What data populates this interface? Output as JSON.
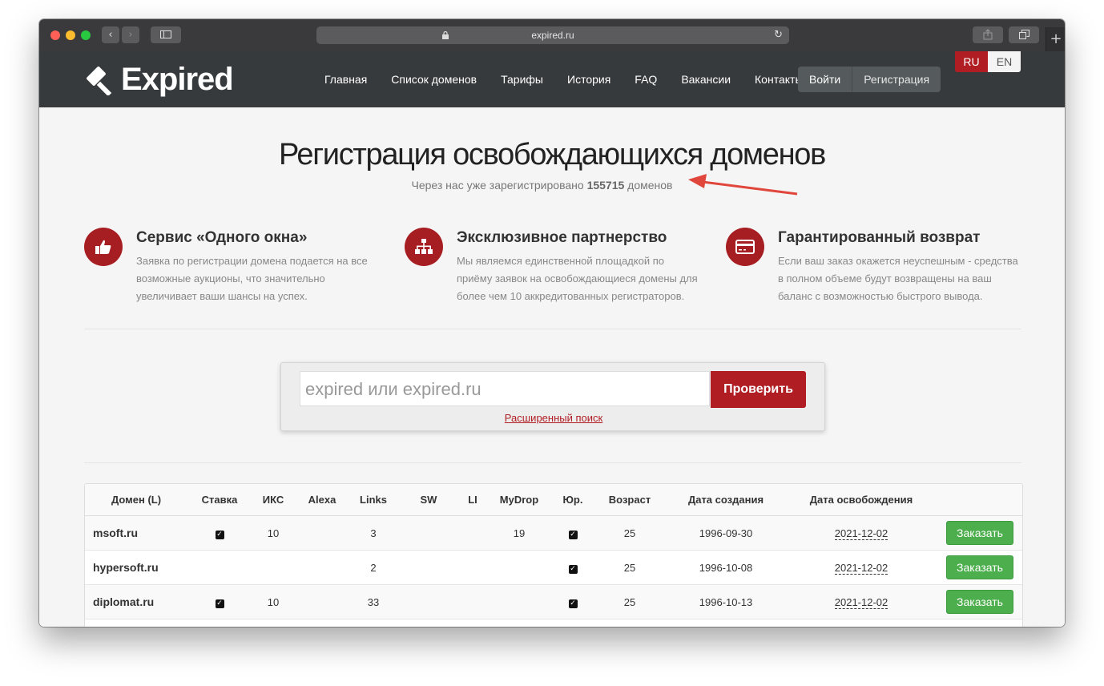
{
  "browser": {
    "url": "expired.ru",
    "back_icon": "chevron-left",
    "forward_icon": "chevron-right",
    "sidebar_icon": "sidebar",
    "share_icon": "share",
    "tabs_icon": "tabs",
    "new_tab_label": "+"
  },
  "header": {
    "logo_text": "Expired",
    "nav": [
      "Главная",
      "Список доменов",
      "Тарифы",
      "История",
      "FAQ",
      "Вакансии",
      "Контакты"
    ],
    "login": "Войти",
    "register": "Регистрация",
    "lang_ru": "RU",
    "lang_en": "EN"
  },
  "hero": {
    "title": "Регистрация освобождающихся доменов",
    "subtitle_pre": "Через нас уже зарегистрировано ",
    "count": "155715",
    "subtitle_post": " доменов"
  },
  "features": [
    {
      "icon": "thumbs-up-icon",
      "title": "Сервис «Одного окна»",
      "desc": "Заявка по регистрации домена подается на все возможные аукционы, что значительно увеличивает ваши шансы на успех."
    },
    {
      "icon": "sitemap-icon",
      "title": "Эксклюзивное партнерство",
      "desc": "Мы являемся единственной площадкой по приёму заявок на освобождающиеся домены для более чем 10 аккредитованных регистраторов."
    },
    {
      "icon": "credit-card-icon",
      "title": "Гарантированный возврат",
      "desc": "Если ваш заказ окажется неуспешным - средства в полном объеме будут возвращены на ваш баланс с возможностью быстрого вывода."
    }
  ],
  "search": {
    "placeholder": "expired или expired.ru",
    "button": "Проверить",
    "advanced": "Расширенный поиск"
  },
  "table": {
    "columns": [
      "Домен (L)",
      "Ставка",
      "ИКС",
      "Alexa",
      "Links",
      "SW",
      "LI",
      "MyDrop",
      "Юр.",
      "Возраст",
      "Дата создания",
      "Дата освобождения",
      ""
    ],
    "rows": [
      {
        "domain": "msoft.ru",
        "bid": true,
        "iks": "10",
        "alexa": "",
        "links": "3",
        "sw": "",
        "li": "",
        "mydrop": "19",
        "legal": true,
        "age": "25",
        "created": "1996-09-30",
        "released": "2021-12-02",
        "action": "Заказать"
      },
      {
        "domain": "hypersoft.ru",
        "bid": false,
        "iks": "",
        "alexa": "",
        "links": "2",
        "sw": "",
        "li": "",
        "mydrop": "",
        "legal": true,
        "age": "25",
        "created": "1996-10-08",
        "released": "2021-12-02",
        "action": "Заказать"
      },
      {
        "domain": "diplomat.ru",
        "bid": true,
        "iks": "10",
        "alexa": "",
        "links": "33",
        "sw": "",
        "li": "",
        "mydrop": "",
        "legal": true,
        "age": "25",
        "created": "1996-10-13",
        "released": "2021-12-02",
        "action": "Заказать"
      }
    ]
  },
  "colors": {
    "brand_red": "#b01e24",
    "header_bg": "#373a3c",
    "order_green": "#4cae4c",
    "annotation_arrow": "#e0463c"
  }
}
